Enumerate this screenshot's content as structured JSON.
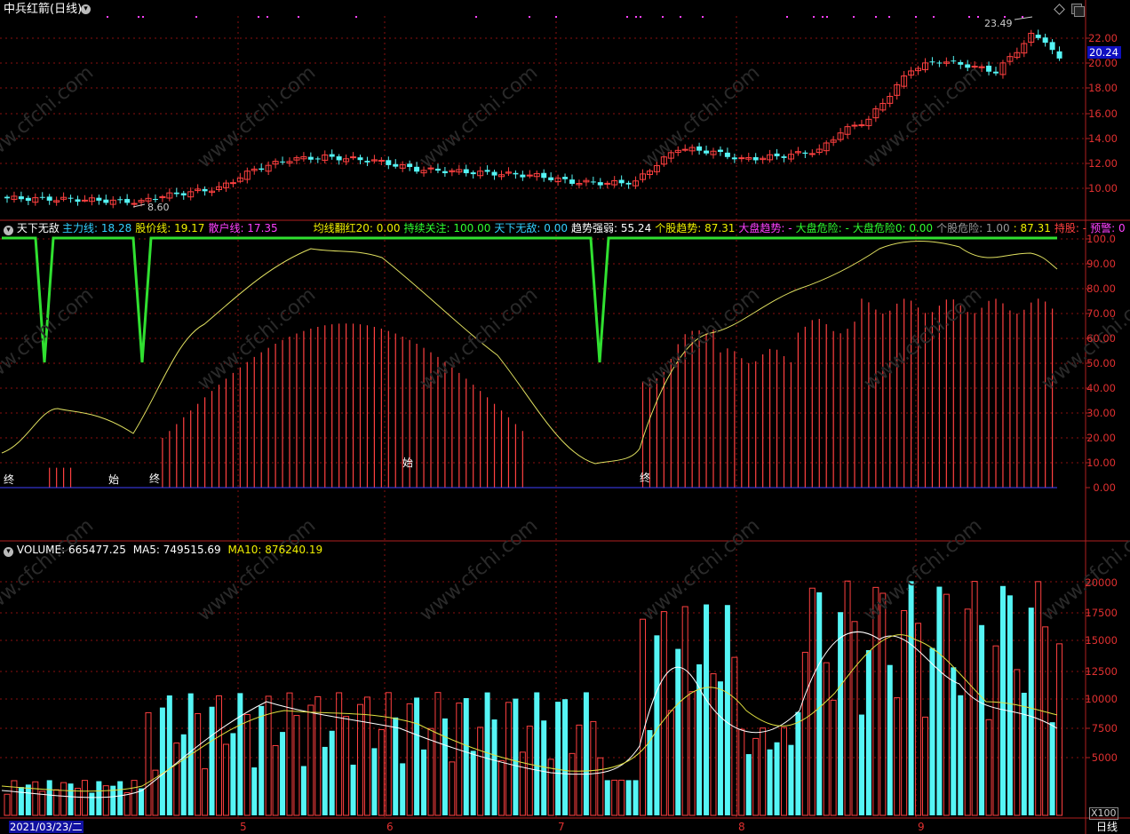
{
  "header": {
    "title": "中兵红箭",
    "period_tag": "(日线)",
    "current_price": "20.24",
    "high_marker": "23.49",
    "low_marker": "8.60"
  },
  "price_axis": [
    "22.00",
    "20.00",
    "18.00",
    "16.00",
    "14.00",
    "12.00",
    "10.00"
  ],
  "indicator": {
    "name": "天下无敌",
    "items": [
      {
        "label": "主力线:",
        "value": "18.28",
        "color": "#33d0ff"
      },
      {
        "label": "股价线:",
        "value": "19.17",
        "color": "#f0f000"
      },
      {
        "label": "散户线:",
        "value": "17.35",
        "color": "#ff40ff"
      },
      {
        "label": "均线翻红20:",
        "value": "0.00",
        "color": "#f0f000"
      },
      {
        "label": "持续关注:",
        "value": "100.00",
        "color": "#30ff30"
      },
      {
        "label": "天下无敌:",
        "value": "0.00",
        "color": "#33d0ff"
      },
      {
        "label": "趋势强弱:",
        "value": "55.24",
        "color": "#ffffff"
      },
      {
        "label": "个股趋势:",
        "value": "87.31",
        "color": "#f0f000"
      },
      {
        "label": "大盘趋势:",
        "value": "-",
        "color": "#ff40ff"
      },
      {
        "label": "大盘危险:",
        "value": "-",
        "color": "#30ff30"
      },
      {
        "label": "大盘危险0:",
        "value": "0.00",
        "color": "#30ff30"
      },
      {
        "label": "个股危险:",
        "value": "1.00",
        "color": "#999999"
      },
      {
        "label": ":",
        "value": "87.31",
        "color": "#f0f000"
      },
      {
        "label": "持股:",
        "value": "-",
        "color": "#ff4040"
      },
      {
        "label": "预警:",
        "value": "0",
        "color": "#ff40ff"
      }
    ],
    "axis": [
      "100.0",
      "90.00",
      "80.00",
      "70.00",
      "60.00",
      "50.00",
      "40.00",
      "30.00",
      "20.00",
      "10.00",
      "0.00"
    ],
    "marks": [
      {
        "text": "终"
      },
      {
        "text": "始"
      },
      {
        "text": "终"
      },
      {
        "text": "始"
      },
      {
        "text": "终"
      }
    ]
  },
  "volume": {
    "name": "VOLUME:",
    "value": "665477.25",
    "ma5_label": "MA5:",
    "ma5_value": "749515.69",
    "ma10_label": "MA10:",
    "ma10_value": "876240.19",
    "axis": [
      "20000",
      "17500",
      "15000",
      "12500",
      "10000",
      "7500",
      "5000"
    ],
    "unit": "X100"
  },
  "bottom": {
    "date": "2021/03/23/二",
    "months": [
      "5",
      "6",
      "7",
      "8",
      "9"
    ],
    "period": "日线"
  },
  "watermark": "www.cfchi.com",
  "colors": {
    "up": "#ff4040",
    "down": "#55f5f5",
    "grid": "#8a1010",
    "border": "#b02020"
  }
}
